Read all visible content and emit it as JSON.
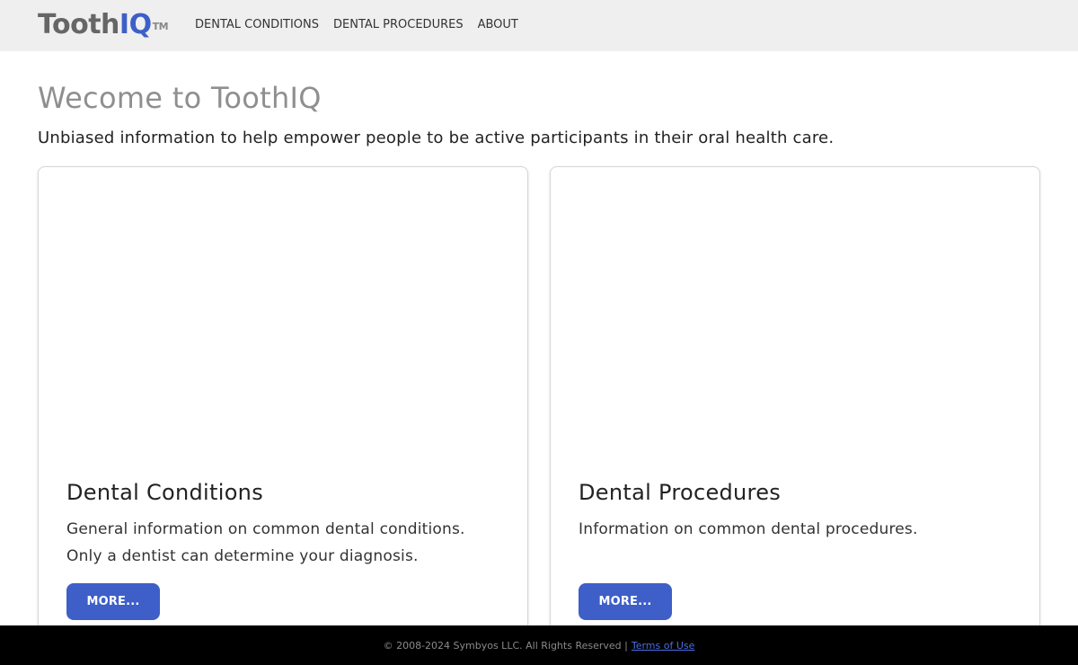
{
  "navbar": {
    "logo_main": "Tooth",
    "logo_accent": "IQ",
    "logo_tm": "TM",
    "links": [
      {
        "label": "DENTAL CONDITIONS"
      },
      {
        "label": "DENTAL PROCEDURES"
      },
      {
        "label": "ABOUT"
      }
    ]
  },
  "main": {
    "title": "Wecome to ToothIQ",
    "subtitle": "Unbiased information to help empower people to be active participants in their oral health care.",
    "cards": [
      {
        "title": "Dental Conditions",
        "text": "General information on common dental conditions. Only a dentist can determine your diagnosis.",
        "button_label": "MORE..."
      },
      {
        "title": "Dental Procedures",
        "text": "Information on common dental procedures.",
        "button_label": "MORE..."
      }
    ]
  },
  "footer": {
    "copyright": "© 2008-2024 Symbyos LLC. All Rights Reserved |",
    "terms_link": "Terms of Use"
  },
  "colors": {
    "accent": "#3e5fc8",
    "navbar_bg": "#efefef",
    "footer_bg": "#000000"
  }
}
